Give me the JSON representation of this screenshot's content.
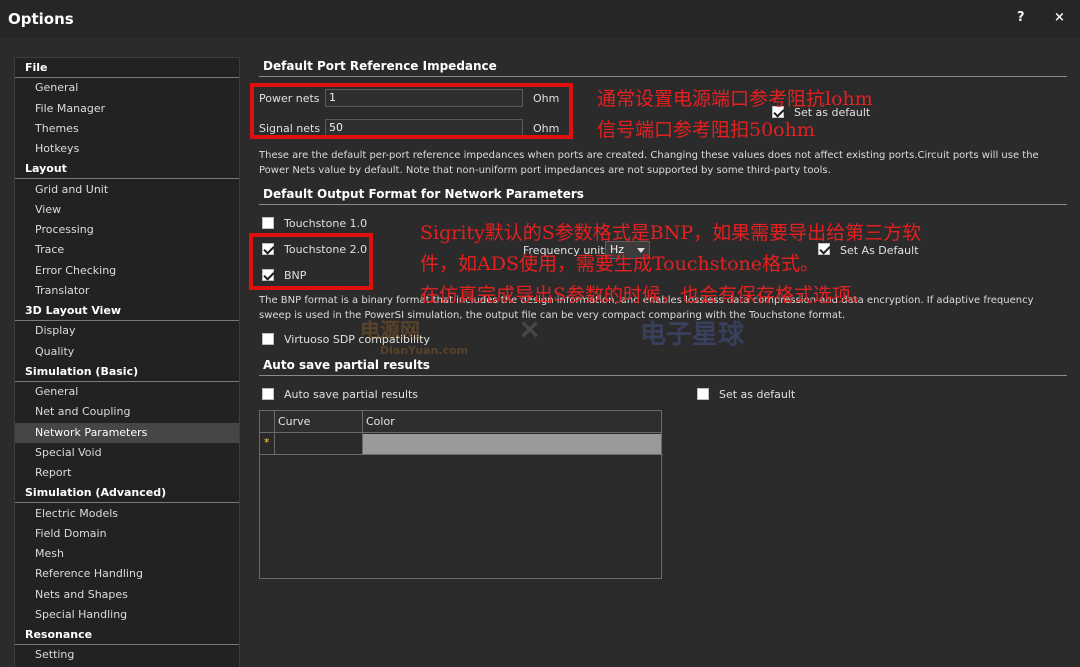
{
  "window": {
    "title": "Options",
    "help_label": "?",
    "close_label": "×"
  },
  "sidebar": {
    "selected": "Network Parameters",
    "rows": [
      {
        "type": "cat",
        "label": "File"
      },
      {
        "type": "item",
        "label": "General"
      },
      {
        "type": "item",
        "label": "File Manager"
      },
      {
        "type": "item",
        "label": "Themes"
      },
      {
        "type": "item",
        "label": "Hotkeys"
      },
      {
        "type": "cat",
        "label": "Layout"
      },
      {
        "type": "item",
        "label": "Grid and Unit"
      },
      {
        "type": "item",
        "label": "View"
      },
      {
        "type": "item",
        "label": "Processing"
      },
      {
        "type": "item",
        "label": "Trace"
      },
      {
        "type": "item",
        "label": "Error Checking"
      },
      {
        "type": "item",
        "label": "Translator"
      },
      {
        "type": "cat",
        "label": "3D Layout View"
      },
      {
        "type": "item",
        "label": "Display"
      },
      {
        "type": "item",
        "label": "Quality"
      },
      {
        "type": "cat",
        "label": "Simulation (Basic)"
      },
      {
        "type": "item",
        "label": "General"
      },
      {
        "type": "item",
        "label": "Net and Coupling"
      },
      {
        "type": "item",
        "label": "Network Parameters"
      },
      {
        "type": "item",
        "label": "Special Void"
      },
      {
        "type": "item",
        "label": "Report"
      },
      {
        "type": "cat",
        "label": "Simulation (Advanced)"
      },
      {
        "type": "item",
        "label": "Electric Models"
      },
      {
        "type": "item",
        "label": "Field Domain"
      },
      {
        "type": "item",
        "label": "Mesh"
      },
      {
        "type": "item",
        "label": "Reference Handling"
      },
      {
        "type": "item",
        "label": "Nets and Shapes"
      },
      {
        "type": "item",
        "label": "Special Handling"
      },
      {
        "type": "cat",
        "label": "Resonance"
      },
      {
        "type": "item",
        "label": "Setting"
      }
    ]
  },
  "impedance": {
    "heading": "Default Port Reference Impedance",
    "power_label": "Power nets",
    "power_value": "1",
    "signal_label": "Signal nets",
    "signal_value": "50",
    "unit": "Ohm",
    "set_default_label": "Set as default",
    "set_default_checked": true,
    "description": "These are the default per-port reference impedances when ports are created.  Changing these values does not affect existing ports.Circuit ports will use the Power Nets value by default. Note that non-uniform port impedances are not supported by some third-party tools."
  },
  "output_format": {
    "heading": "Default Output Format for Network Parameters",
    "touchstone1_label": "Touchstone 1.0",
    "touchstone1_checked": false,
    "touchstone2_label": "Touchstone 2.0",
    "touchstone2_checked": true,
    "bnp_label": "BNP",
    "bnp_checked": true,
    "freq_unit_label": "Frequency unit",
    "freq_unit_value": "Hz",
    "set_default_label": "Set As Default",
    "set_default_checked": true,
    "description": "The BNP format is a binary format that includes the design information, and enables lossless data compression and data encryption. If adaptive frequency sweep is used in the PowerSI simulation, the output file can be very compact comparing with the Touchstone format.",
    "virtuoso_label": "Virtuoso SDP compatibility",
    "virtuoso_checked": false
  },
  "autosave": {
    "heading": "Auto save partial results",
    "checkbox_label": "Auto save partial results",
    "checkbox_checked": false,
    "set_default_label": "Set as default",
    "set_default_checked": false,
    "columns": [
      "Curve",
      "Color"
    ],
    "new_row_marker": "*"
  },
  "annotations": {
    "note1_line1": "通常设置电源端口参考阻抗lohm",
    "note1_line2": "信号端口参考阻抇50ohm",
    "note2_line1": "Sigrity默认的S参数格式是BNP，如果需要导出给第三方软",
    "note2_line2": "件，如ADS使用，需要生成Touchstone格式。",
    "note2_line3": "在仿真完成导出S参数的时候，也会有保存格式选项。",
    "color": "#e52020"
  },
  "watermark": {
    "left": "电源网",
    "left_sub": "DianYuan.com",
    "sep": "×",
    "right": "电子星球"
  }
}
